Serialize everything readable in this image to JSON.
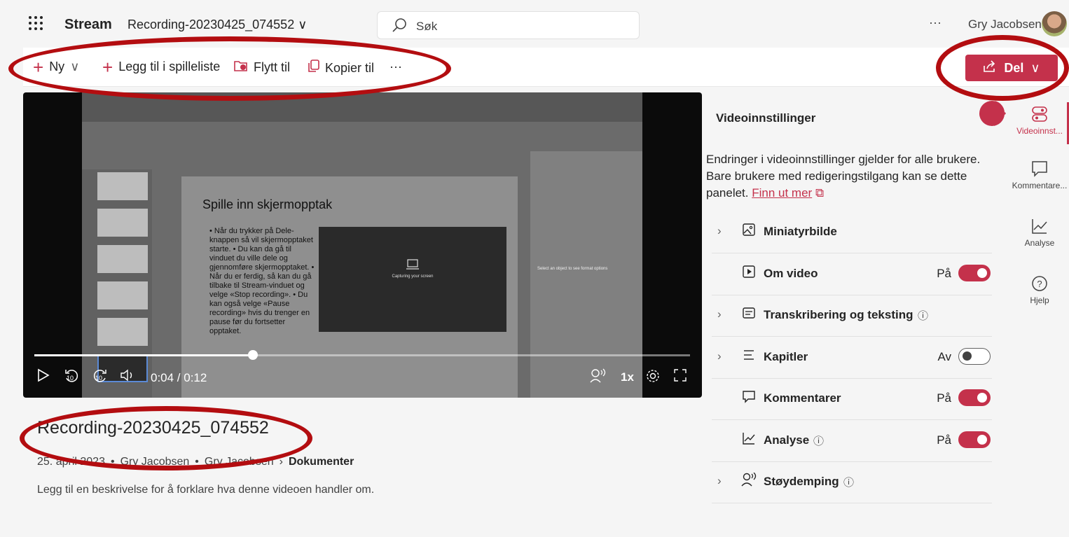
{
  "header": {
    "waffle": "⠇⠇⠇",
    "app_name": "Stream",
    "file_title": "Recording-20230425_074552",
    "search_placeholder": "Søk",
    "more": "···",
    "user_name": "Gry Jacobsen"
  },
  "commands": {
    "new": "Ny",
    "add_playlist": "Legg til i spilleliste",
    "move": "Flytt til",
    "copy": "Kopier til",
    "more": "···",
    "share": "Del"
  },
  "video": {
    "current_time": "0:04",
    "duration": "0:12",
    "time_display": "0:04 / 0:12",
    "progress_fraction": 0.333,
    "speed": "1x",
    "skip_back": "10",
    "skip_forward": "10",
    "slide_title": "Spille inn skjermopptak",
    "slide_bullets": "• Når du trykker på Dele-knappen så vil skjermopptaket starte. • Du kan da gå til vinduet du ville dele og gjennomføre skjermopptaket. • Når du er ferdig, så kan du gå tilbake til Stream-vinduet og velge «Stop recording». • Du kan også velge «Pause recording» hvis du trenger en pause før du fortsetter opptaket.",
    "capture_text": "Capturing your screen",
    "format_text": "Select an object to see format options"
  },
  "details": {
    "title": "Recording-20230425_074552",
    "date": "25. april 2023",
    "bullet": "•",
    "owner": "Gry Jacobsen",
    "path_user": "Gry Jacobsen",
    "path_folder": "Dokumenter",
    "description_placeholder": "Legg til en beskrivelse for å forklare hva denne videoen handler om."
  },
  "settings_panel": {
    "title": "Videoinnstillinger",
    "description": "Endringer i videoinnstillinger gjelder for alle brukere. Bare brukere med redigeringstilgang kan se dette panelet.",
    "learn_more": "Finn ut mer",
    "rows": [
      {
        "label": "Miniatyrbilde",
        "state": "",
        "toggle": null,
        "icon": "image-icon"
      },
      {
        "label": "Om video",
        "state": "På",
        "toggle": true,
        "icon": "play-box-icon"
      },
      {
        "label": "Transkribering og teksting",
        "state": "",
        "toggle": null,
        "icon": "transcript-icon"
      },
      {
        "label": "Kapitler",
        "state": "Av",
        "toggle": false,
        "icon": "chapters-icon"
      },
      {
        "label": "Kommentarer",
        "state": "På",
        "toggle": true,
        "icon": "comment-icon"
      },
      {
        "label": "Analyse",
        "state": "På",
        "toggle": true,
        "icon": "analytics-icon"
      },
      {
        "label": "Støydemping",
        "state": "",
        "toggle": null,
        "icon": "noise-icon"
      }
    ]
  },
  "rail": {
    "settings": "Videoinnst...",
    "comments": "Kommentare...",
    "analytics": "Analyse",
    "help": "Hjelp"
  },
  "colors": {
    "accent": "#c4314b",
    "annotation": "#b30d10"
  }
}
